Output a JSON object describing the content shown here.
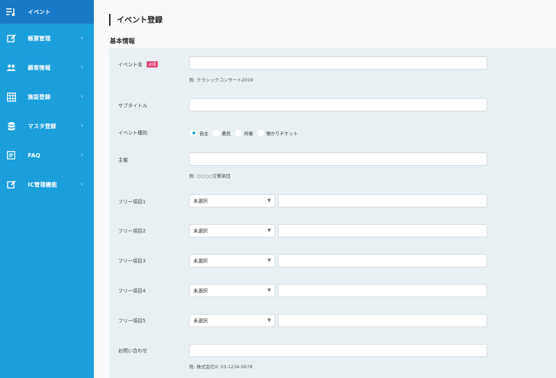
{
  "sidebar": {
    "items": [
      {
        "label": "イベント",
        "icon": "event-list-icon",
        "active": true
      },
      {
        "label": "帳票管理",
        "icon": "edit-icon",
        "active": false
      },
      {
        "label": "顧客情報",
        "icon": "users-icon",
        "active": false
      },
      {
        "label": "施設登録",
        "icon": "calendar-grid-icon",
        "active": false
      },
      {
        "label": "マスタ登録",
        "icon": "database-icon",
        "active": false
      },
      {
        "label": "FAQ",
        "icon": "faq-icon",
        "active": false
      },
      {
        "label": "IC管理機能",
        "icon": "edit-icon",
        "active": false
      }
    ],
    "chevron": "›"
  },
  "main": {
    "title": "イベント登録",
    "section_title": "基本情報"
  },
  "form": {
    "event_name": {
      "label": "イベント名",
      "required_badge": "必須",
      "value": "",
      "hint": "例: クラシックコンサート2019"
    },
    "subtitle": {
      "label": "サブタイトル",
      "value": ""
    },
    "event_type": {
      "label": "イベント種別",
      "options": [
        "自主",
        "委託",
        "共催",
        "預かりチケット"
      ],
      "selected": "自主"
    },
    "organizer": {
      "label": "主催",
      "value": "",
      "hint": "例: ○○○○交響楽団"
    },
    "free_items": [
      {
        "label": "フリー項目1",
        "select_value": "未選択",
        "value": ""
      },
      {
        "label": "フリー項目2",
        "select_value": "未選択",
        "value": ""
      },
      {
        "label": "フリー項目3",
        "select_value": "未選択",
        "value": ""
      },
      {
        "label": "フリー項目4",
        "select_value": "未選択",
        "value": ""
      },
      {
        "label": "フリー項目5",
        "select_value": "未選択",
        "value": ""
      }
    ],
    "select_arrow": "▼",
    "contact": {
      "label": "お問い合わせ",
      "value": "",
      "hint": "例: 株式会社IC 03-1234-5678"
    }
  },
  "colors": {
    "sidebar": "#1a9fdb",
    "sidebar_active": "#1879c9",
    "badge": "#e4477a",
    "panel": "#e8f0f3"
  }
}
